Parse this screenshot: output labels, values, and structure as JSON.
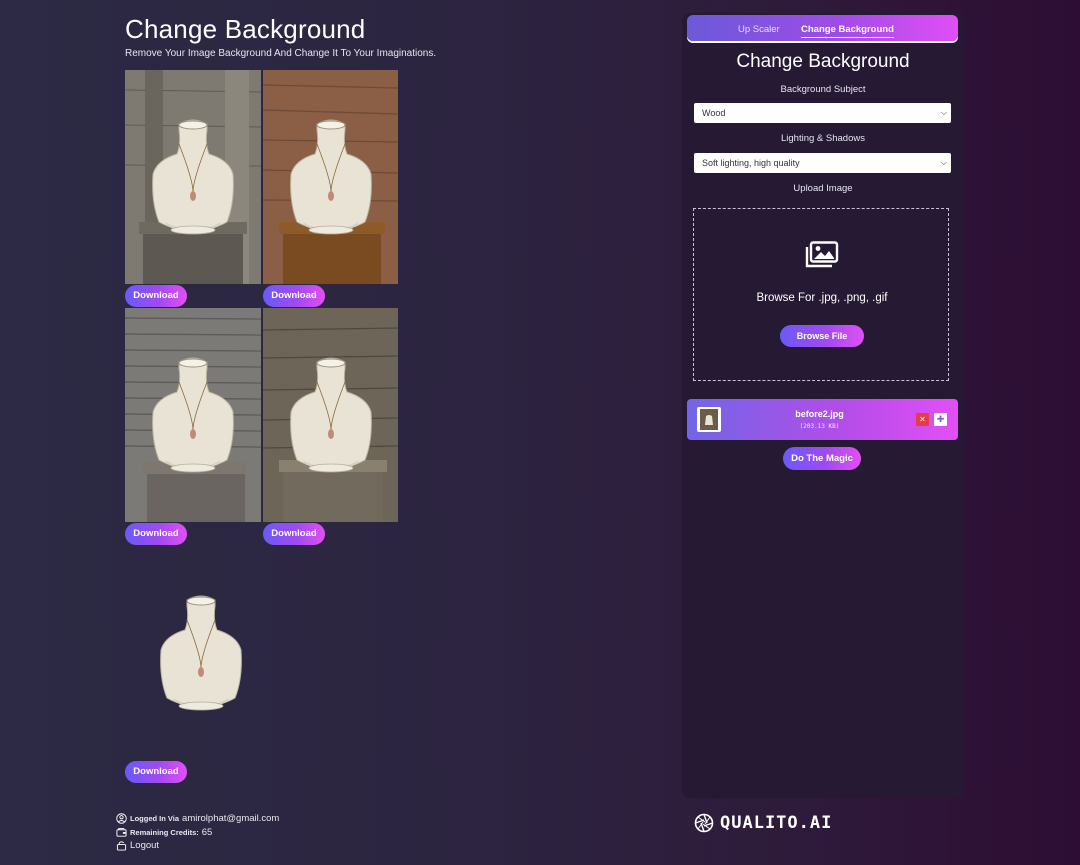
{
  "page": {
    "title": "Change Background",
    "subtitle": "Remove Your Image Background And Change It To Your Imaginations."
  },
  "results": {
    "download_label": "Download",
    "images": [
      {
        "name": "result-wood-gray"
      },
      {
        "name": "result-wood-brown"
      },
      {
        "name": "result-wood-planks"
      },
      {
        "name": "result-wood-weathered"
      },
      {
        "name": "result-transparent"
      }
    ]
  },
  "footer": {
    "logged_label": "Logged In Via",
    "email": "amirolphat@gmail.com",
    "credits_label": "Remaining Credits:",
    "credits_value": "65",
    "logout_label": "Logout"
  },
  "panel": {
    "tabs": [
      {
        "label": "Up Scaler",
        "active": false
      },
      {
        "label": "Change Background",
        "active": true
      }
    ],
    "title": "Change Background",
    "subject_label": "Background Subject",
    "subject_value": "Wood",
    "lighting_label": "Lighting & Shadows",
    "lighting_value": "Soft lighting, high quality",
    "upload_label": "Upload Image",
    "upload_hint": "Browse For .jpg, .png, .gif",
    "browse_button": "Browse File",
    "file": {
      "name": "before2.jpg",
      "size": "(203.13 KB)"
    },
    "magic_button": "Do The Magic"
  },
  "brand": {
    "name": "QUALITO.AI"
  },
  "colors": {
    "accent_start": "#6a5af9",
    "accent_end": "#e24ff5",
    "panel_bg": "#261933",
    "remove_red": "#e53b4a"
  },
  "icons": [
    "gallery-icon",
    "user-icon",
    "credits-icon",
    "logout-icon",
    "brand-logo-icon",
    "close-icon",
    "plus-icon",
    "chevron-down-icon"
  ]
}
